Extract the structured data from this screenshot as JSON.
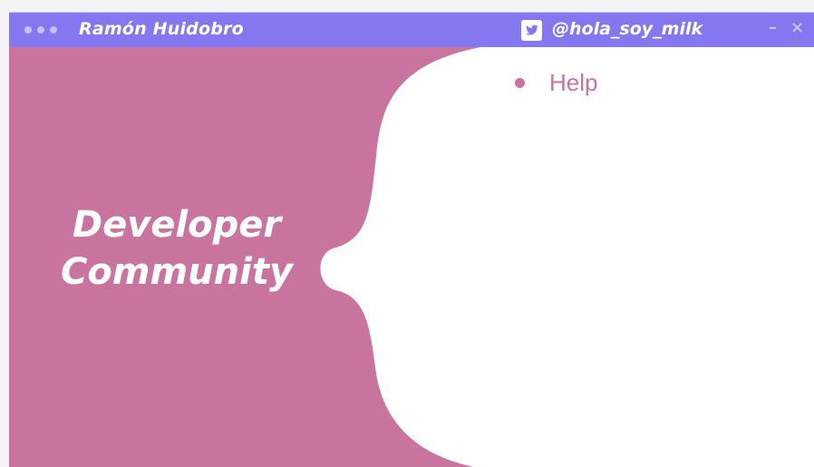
{
  "window": {
    "author_name": "Ramón Huidobro",
    "twitter_handle": "@hola_soy_milk",
    "minimize_glyph": "–",
    "close_glyph": "×",
    "icons": [
      "twitter-icon",
      "minimize-icon",
      "close-icon"
    ]
  },
  "slide": {
    "heading_line1": "Developer",
    "heading_line2": "Community",
    "menu_items": [
      {
        "label": "Help"
      }
    ]
  },
  "colors": {
    "titlebar": "#8577f0",
    "background": "#c8749e",
    "panel": "#ffffff",
    "dots": "#c7bff7",
    "text_accent": "#c8749e"
  }
}
